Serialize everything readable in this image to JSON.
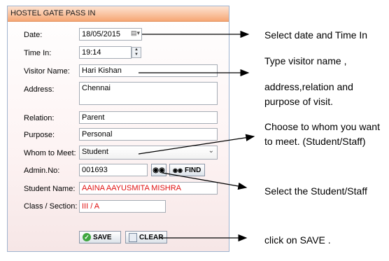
{
  "form": {
    "title": "HOSTEL GATE PASS IN",
    "date_label": "Date:",
    "date_value": "18/05/2015",
    "time_label": "Time In:",
    "time_value": "19:14",
    "visitor_label": "Visitor Name:",
    "visitor_value": "Hari Kishan",
    "address_label": "Address:",
    "address_value": "Chennai",
    "relation_label": "Relation:",
    "relation_value": "Parent",
    "purpose_label": "Purpose:",
    "purpose_value": "Personal",
    "whom_label": "Whom to Meet:",
    "whom_value": "Student",
    "admin_label": "Admin.No:",
    "admin_value": "001693",
    "find_label": "FIND",
    "student_label": "Student Name:",
    "student_value": "AAINA AAYUSMITA MISHRA",
    "class_label": "Class / Section:",
    "class_value": "III / A",
    "save_label": "SAVE",
    "clear_label": "CLEAR"
  },
  "notes": {
    "date_note": "Select date and Time In",
    "visitor_note_1": "Type visitor  name ,",
    "visitor_note_2": "address,relation and",
    "visitor_note_3": "purpose of visit.",
    "whom_note_1": "Choose to whom you want",
    "whom_note_2": "to meet. (Student/Staff)",
    "select_note": "Select the Student/Staff",
    "save_note": "click on SAVE ."
  }
}
